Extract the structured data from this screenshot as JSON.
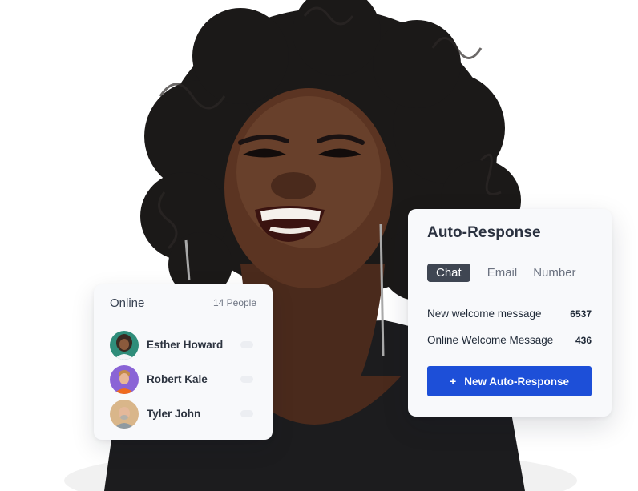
{
  "online": {
    "title": "Online",
    "count": "14 People",
    "people": [
      {
        "name": "Esther Howard",
        "avatar_bg": "#2f8d7a",
        "shirt": "#f3f4f6"
      },
      {
        "name": "Robert Kale",
        "avatar_bg": "#8a64d6",
        "shirt": "#ef6b1f"
      },
      {
        "name": "Tyler John",
        "avatar_bg": "#d9b68a",
        "shirt": "#8f9aa0"
      }
    ]
  },
  "auto_response": {
    "title": "Auto-Response",
    "tabs": [
      "Chat",
      "Email",
      "Number"
    ],
    "active_tab": "Chat",
    "messages": [
      {
        "label": "New welcome message",
        "count": "6537"
      },
      {
        "label": "Online Welcome Message",
        "count": "436"
      }
    ],
    "button_plus": "+",
    "button_label": "New Auto-Response"
  },
  "colors": {
    "primary_button": "#1d4fd8",
    "active_tab": "#3f4652",
    "card_bg": "#f8f9fb"
  }
}
